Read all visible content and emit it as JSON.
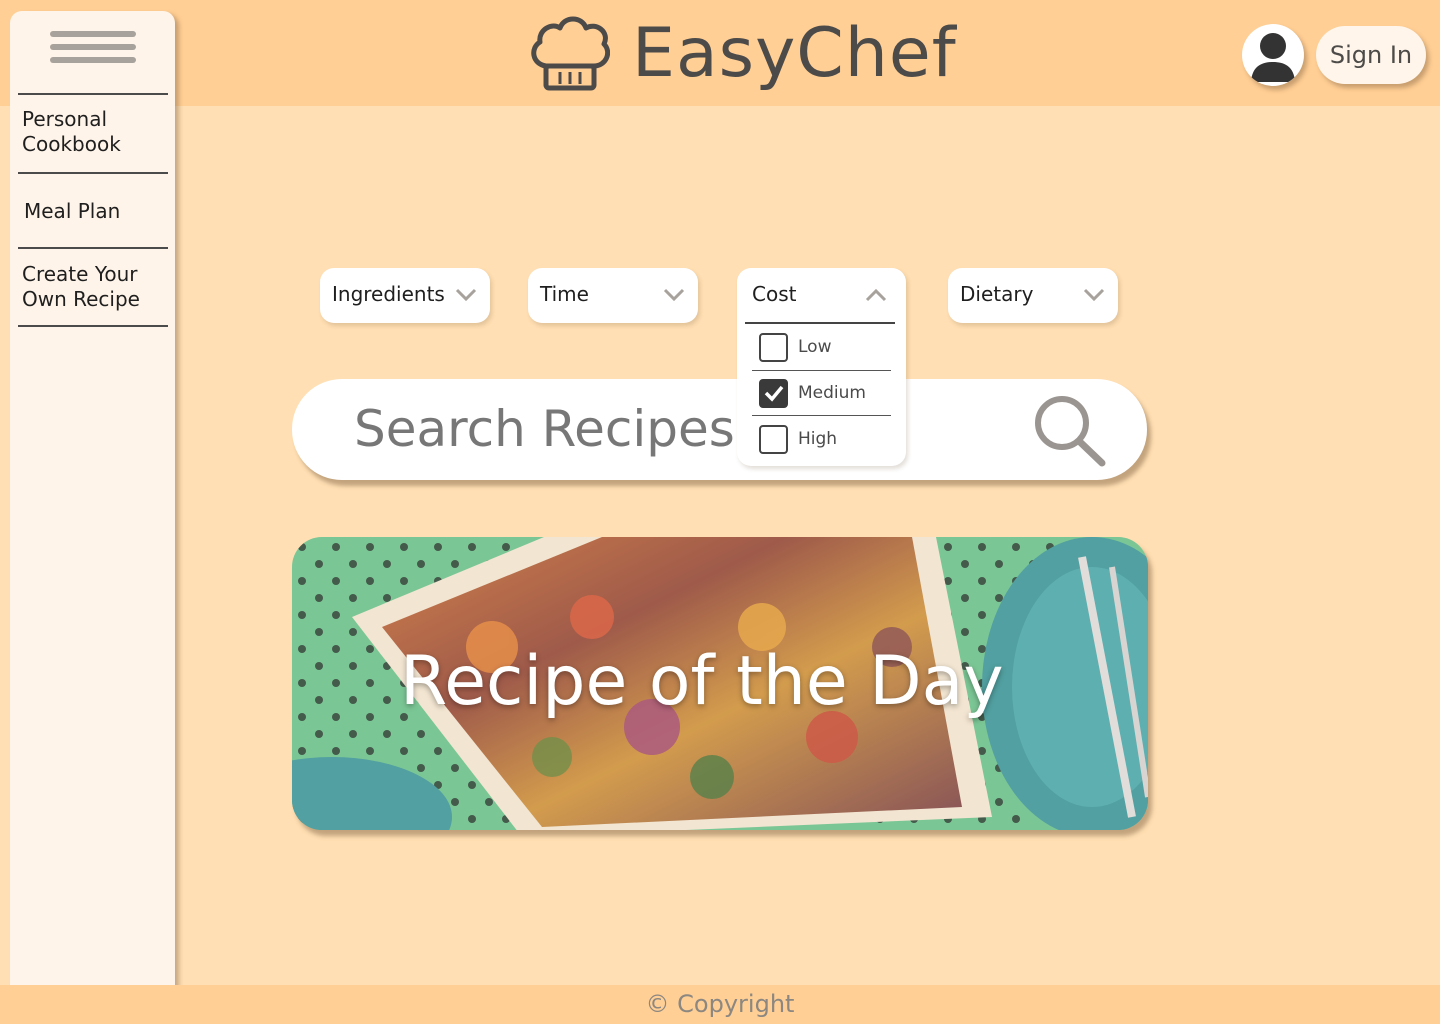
{
  "app": {
    "name": "EasyChef"
  },
  "header": {
    "sign_in_label": "Sign In"
  },
  "sidebar": {
    "items": [
      {
        "label": "Personal Cookbook"
      },
      {
        "label": "Meal Plan"
      },
      {
        "label": "Create Your Own Recipe"
      }
    ]
  },
  "filters": {
    "ingredients_label": "Ingredients",
    "time_label": "Time",
    "cost_label": "Cost",
    "dietary_label": "Dietary",
    "cost_options": [
      {
        "label": "Low",
        "checked": false
      },
      {
        "label": "Medium",
        "checked": true
      },
      {
        "label": "High",
        "checked": false
      }
    ]
  },
  "search": {
    "placeholder": "Search Recipes"
  },
  "featured": {
    "title": "Recipe of the Day"
  },
  "footer": {
    "copyright": "© Copyright"
  },
  "colors": {
    "header_bg": "#ffcf95",
    "page_bg": "#ffdfb3",
    "sidebar_bg": "#fff4e9",
    "brand_text": "#4d4b49"
  }
}
